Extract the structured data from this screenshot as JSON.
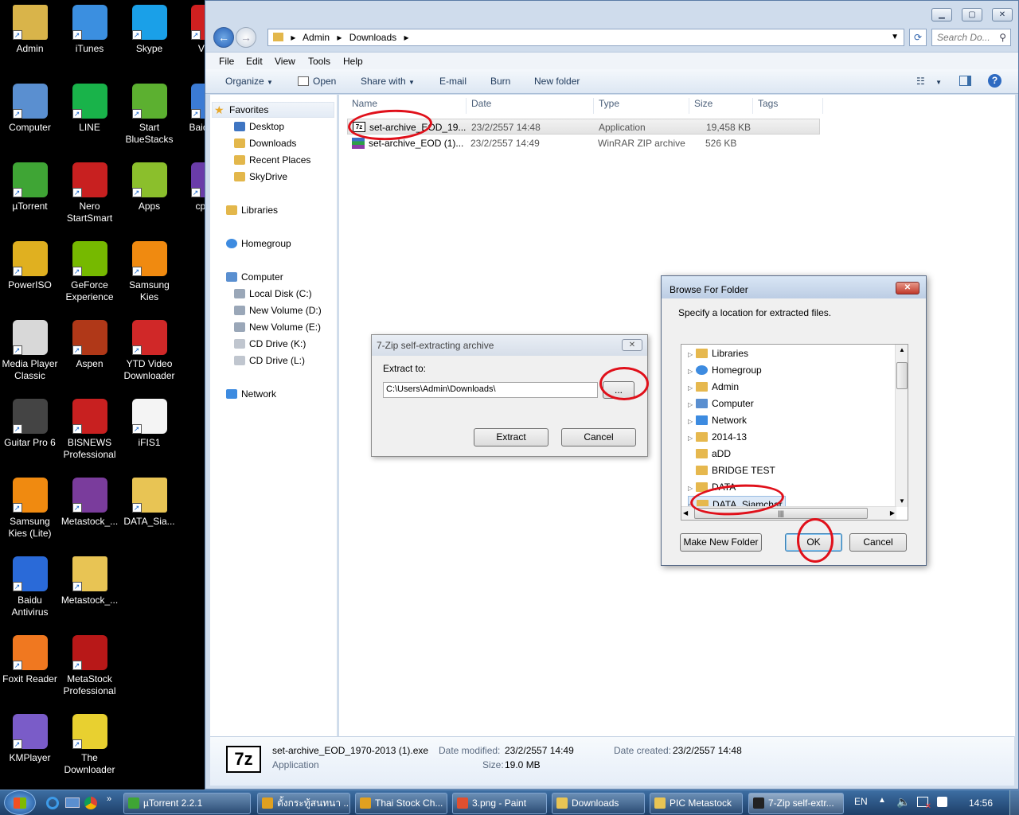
{
  "desktop": {
    "icons": [
      {
        "label": "Admin",
        "icon": "user-folder-icon",
        "color": "#d9b44a"
      },
      {
        "label": "iTunes",
        "icon": "itunes-icon",
        "color": "#3b8fe0"
      },
      {
        "label": "Skype",
        "icon": "skype-icon",
        "color": "#1aa0e8"
      },
      {
        "label": "VNC",
        "icon": "vnc-icon",
        "color": "#d02020"
      },
      {
        "label": "Computer",
        "icon": "computer-icon",
        "color": "#5a8fd0"
      },
      {
        "label": "LINE",
        "icon": "line-icon",
        "color": "#19b34a"
      },
      {
        "label": "Start BlueStacks",
        "icon": "bluestacks-icon",
        "color": "#5cb030"
      },
      {
        "label": "Baidu Fa",
        "icon": "baidu-icon",
        "color": "#3b7bd4"
      },
      {
        "label": "µTorrent",
        "icon": "utorrent-icon",
        "color": "#3fa535"
      },
      {
        "label": "Nero StartSmart",
        "icon": "nero-icon",
        "color": "#c82020"
      },
      {
        "label": "Apps",
        "icon": "android-icon",
        "color": "#8bbf2c"
      },
      {
        "label": "cpuz_",
        "icon": "cpuz-icon",
        "color": "#6a3ca8"
      },
      {
        "label": "PowerISO",
        "icon": "poweriso-icon",
        "color": "#e0b020"
      },
      {
        "label": "GeForce Experience",
        "icon": "geforce-icon",
        "color": "#76b900"
      },
      {
        "label": "Samsung Kies",
        "icon": "kies-icon",
        "color": "#f08a10"
      },
      {
        "label": "Media Player Classic",
        "icon": "mpc-icon",
        "color": "#d8d8d8"
      },
      {
        "label": "Aspen",
        "icon": "aspen-icon",
        "color": "#b03818"
      },
      {
        "label": "YTD Video Downloader",
        "icon": "ytd-icon",
        "color": "#d02828"
      },
      {
        "label": "Guitar Pro 6",
        "icon": "guitarpro-icon",
        "color": "#444444"
      },
      {
        "label": "BISNEWS Professional",
        "icon": "bisnews-icon",
        "color": "#c82020"
      },
      {
        "label": "iFIS1",
        "icon": "window-icon",
        "color": "#f4f4f4"
      },
      {
        "label": "Samsung Kies (Lite)",
        "icon": "kies-lite-icon",
        "color": "#f08a10"
      },
      {
        "label": "Metastock_...",
        "icon": "winrar-icon",
        "color": "#7a3c9c"
      },
      {
        "label": "DATA_Sia...",
        "icon": "folder-icon",
        "color": "#e8c454"
      },
      {
        "label": "Baidu Antivirus",
        "icon": "baidu-antivirus-icon",
        "color": "#2a6ad8"
      },
      {
        "label": "Metastock_...",
        "icon": "folder-icon",
        "color": "#e8c454"
      },
      {
        "label": "Foxit Reader",
        "icon": "foxit-icon",
        "color": "#f07820"
      },
      {
        "label": "MetaStock Professional",
        "icon": "metastock-icon",
        "color": "#b81818"
      },
      {
        "label": "KMPlayer",
        "icon": "kmplayer-icon",
        "color": "#7a5cc8"
      },
      {
        "label": "The Downloader",
        "icon": "downloader-icon",
        "color": "#e8d030"
      }
    ]
  },
  "explorer": {
    "address": {
      "crumbs": [
        "Admin",
        "Downloads"
      ]
    },
    "search_placeholder": "Search Do...",
    "menu": [
      "File",
      "Edit",
      "View",
      "Tools",
      "Help"
    ],
    "commands": [
      "Organize",
      "Open",
      "Share with",
      "E-mail",
      "Burn",
      "New folder"
    ],
    "nav": {
      "favorites": "Favorites",
      "fav_items": [
        "Desktop",
        "Downloads",
        "Recent Places",
        "SkyDrive"
      ],
      "libraries": "Libraries",
      "homegroup": "Homegroup",
      "computer": "Computer",
      "drives": [
        "Local Disk (C:)",
        "New Volume (D:)",
        "New Volume (E:)",
        "CD Drive (K:)",
        "CD Drive (L:)"
      ],
      "network": "Network"
    },
    "columns": [
      "Name",
      "Date",
      "Type",
      "Size",
      "Tags"
    ],
    "files": [
      {
        "name": "set-archive_EOD_19...",
        "date": "23/2/2557 14:48",
        "type": "Application",
        "size": "19,458 KB"
      },
      {
        "name": "set-archive_EOD (1)...",
        "date": "23/2/2557 14:49",
        "type": "WinRAR ZIP archive",
        "size": "526 KB"
      }
    ],
    "details": {
      "filename": "set-archive_EOD_1970-2013 (1).exe",
      "type": "Application",
      "modified_label": "Date modified:",
      "modified": "23/2/2557 14:49",
      "created_label": "Date created:",
      "created": "23/2/2557 14:48",
      "size_label": "Size:",
      "size": "19.0 MB"
    }
  },
  "sfx_dialog": {
    "title": "7-Zip self-extracting archive",
    "extract_label": "Extract to:",
    "path": "C:\\Users\\Admin\\Downloads\\",
    "browse": "...",
    "extract": "Extract",
    "cancel": "Cancel"
  },
  "browse_dialog": {
    "title": "Browse For Folder",
    "instruction": "Specify a location for extracted files.",
    "tree": [
      "Libraries",
      "Homegroup",
      "Admin",
      "Computer",
      "Network",
      "2014-13",
      "aDD",
      "BRIDGE TEST",
      "DATA",
      "DATA_Siamchar"
    ],
    "make_folder": "Make New Folder",
    "ok": "OK",
    "cancel": "Cancel"
  },
  "taskbar": {
    "items": [
      {
        "label": "µTorrent 2.2.1",
        "color": "#3fa535"
      },
      {
        "label": "ตั้งกระทู้สนทนา ...",
        "color": "#e0a020"
      },
      {
        "label": "Thai Stock Ch...",
        "color": "#e0a020"
      },
      {
        "label": "3.png - Paint",
        "color": "#e05030"
      },
      {
        "label": "Downloads",
        "color": "#e8c454"
      },
      {
        "label": "PIC Metastock",
        "color": "#e8c454"
      },
      {
        "label": "7-Zip self-extr...",
        "color": "#222222"
      }
    ],
    "lang": "EN",
    "time": "14:56"
  }
}
